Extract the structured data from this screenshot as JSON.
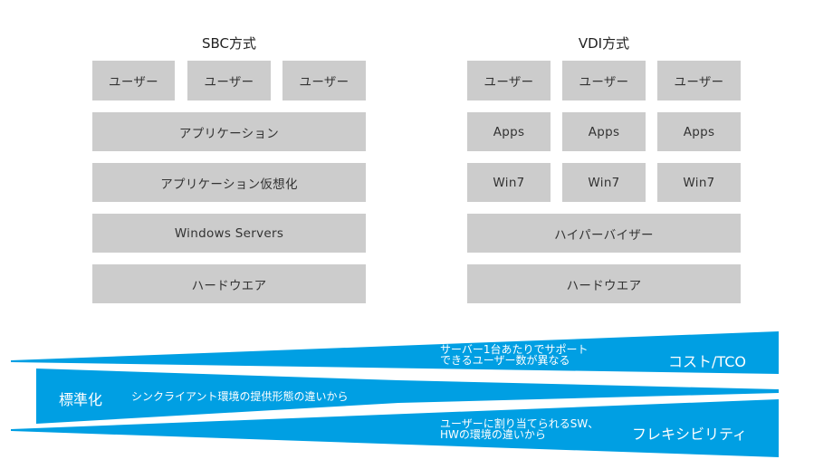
{
  "sbc": {
    "title": "SBC方式",
    "users": [
      "ユーザー",
      "ユーザー",
      "ユーザー"
    ],
    "layers": [
      "アプリケーション",
      "アプリケーション仮想化",
      "Windows Servers",
      "ハードウエア"
    ]
  },
  "vdi": {
    "title": "VDI方式",
    "users": [
      "ユーザー",
      "ユーザー",
      "ユーザー"
    ],
    "apps": [
      "Apps",
      "Apps",
      "Apps"
    ],
    "os": [
      "Win7",
      "Win7",
      "Win7"
    ],
    "layers": [
      "ハイパーバイザー",
      "ハードウエア"
    ]
  },
  "bands": {
    "color": "#009fe3",
    "cost": {
      "label": "コスト/TCO",
      "desc_line1": "サーバー1台あたりでサポート",
      "desc_line2": "できるユーザー数が異なる"
    },
    "standard": {
      "label": "標準化",
      "desc": "シンクライアント環境の提供形態の違いから"
    },
    "flex": {
      "label": "フレキシビリティ",
      "desc_line1": "ユーザーに割り当てられるSW、",
      "desc_line2": "HWの環境の違いから"
    }
  }
}
